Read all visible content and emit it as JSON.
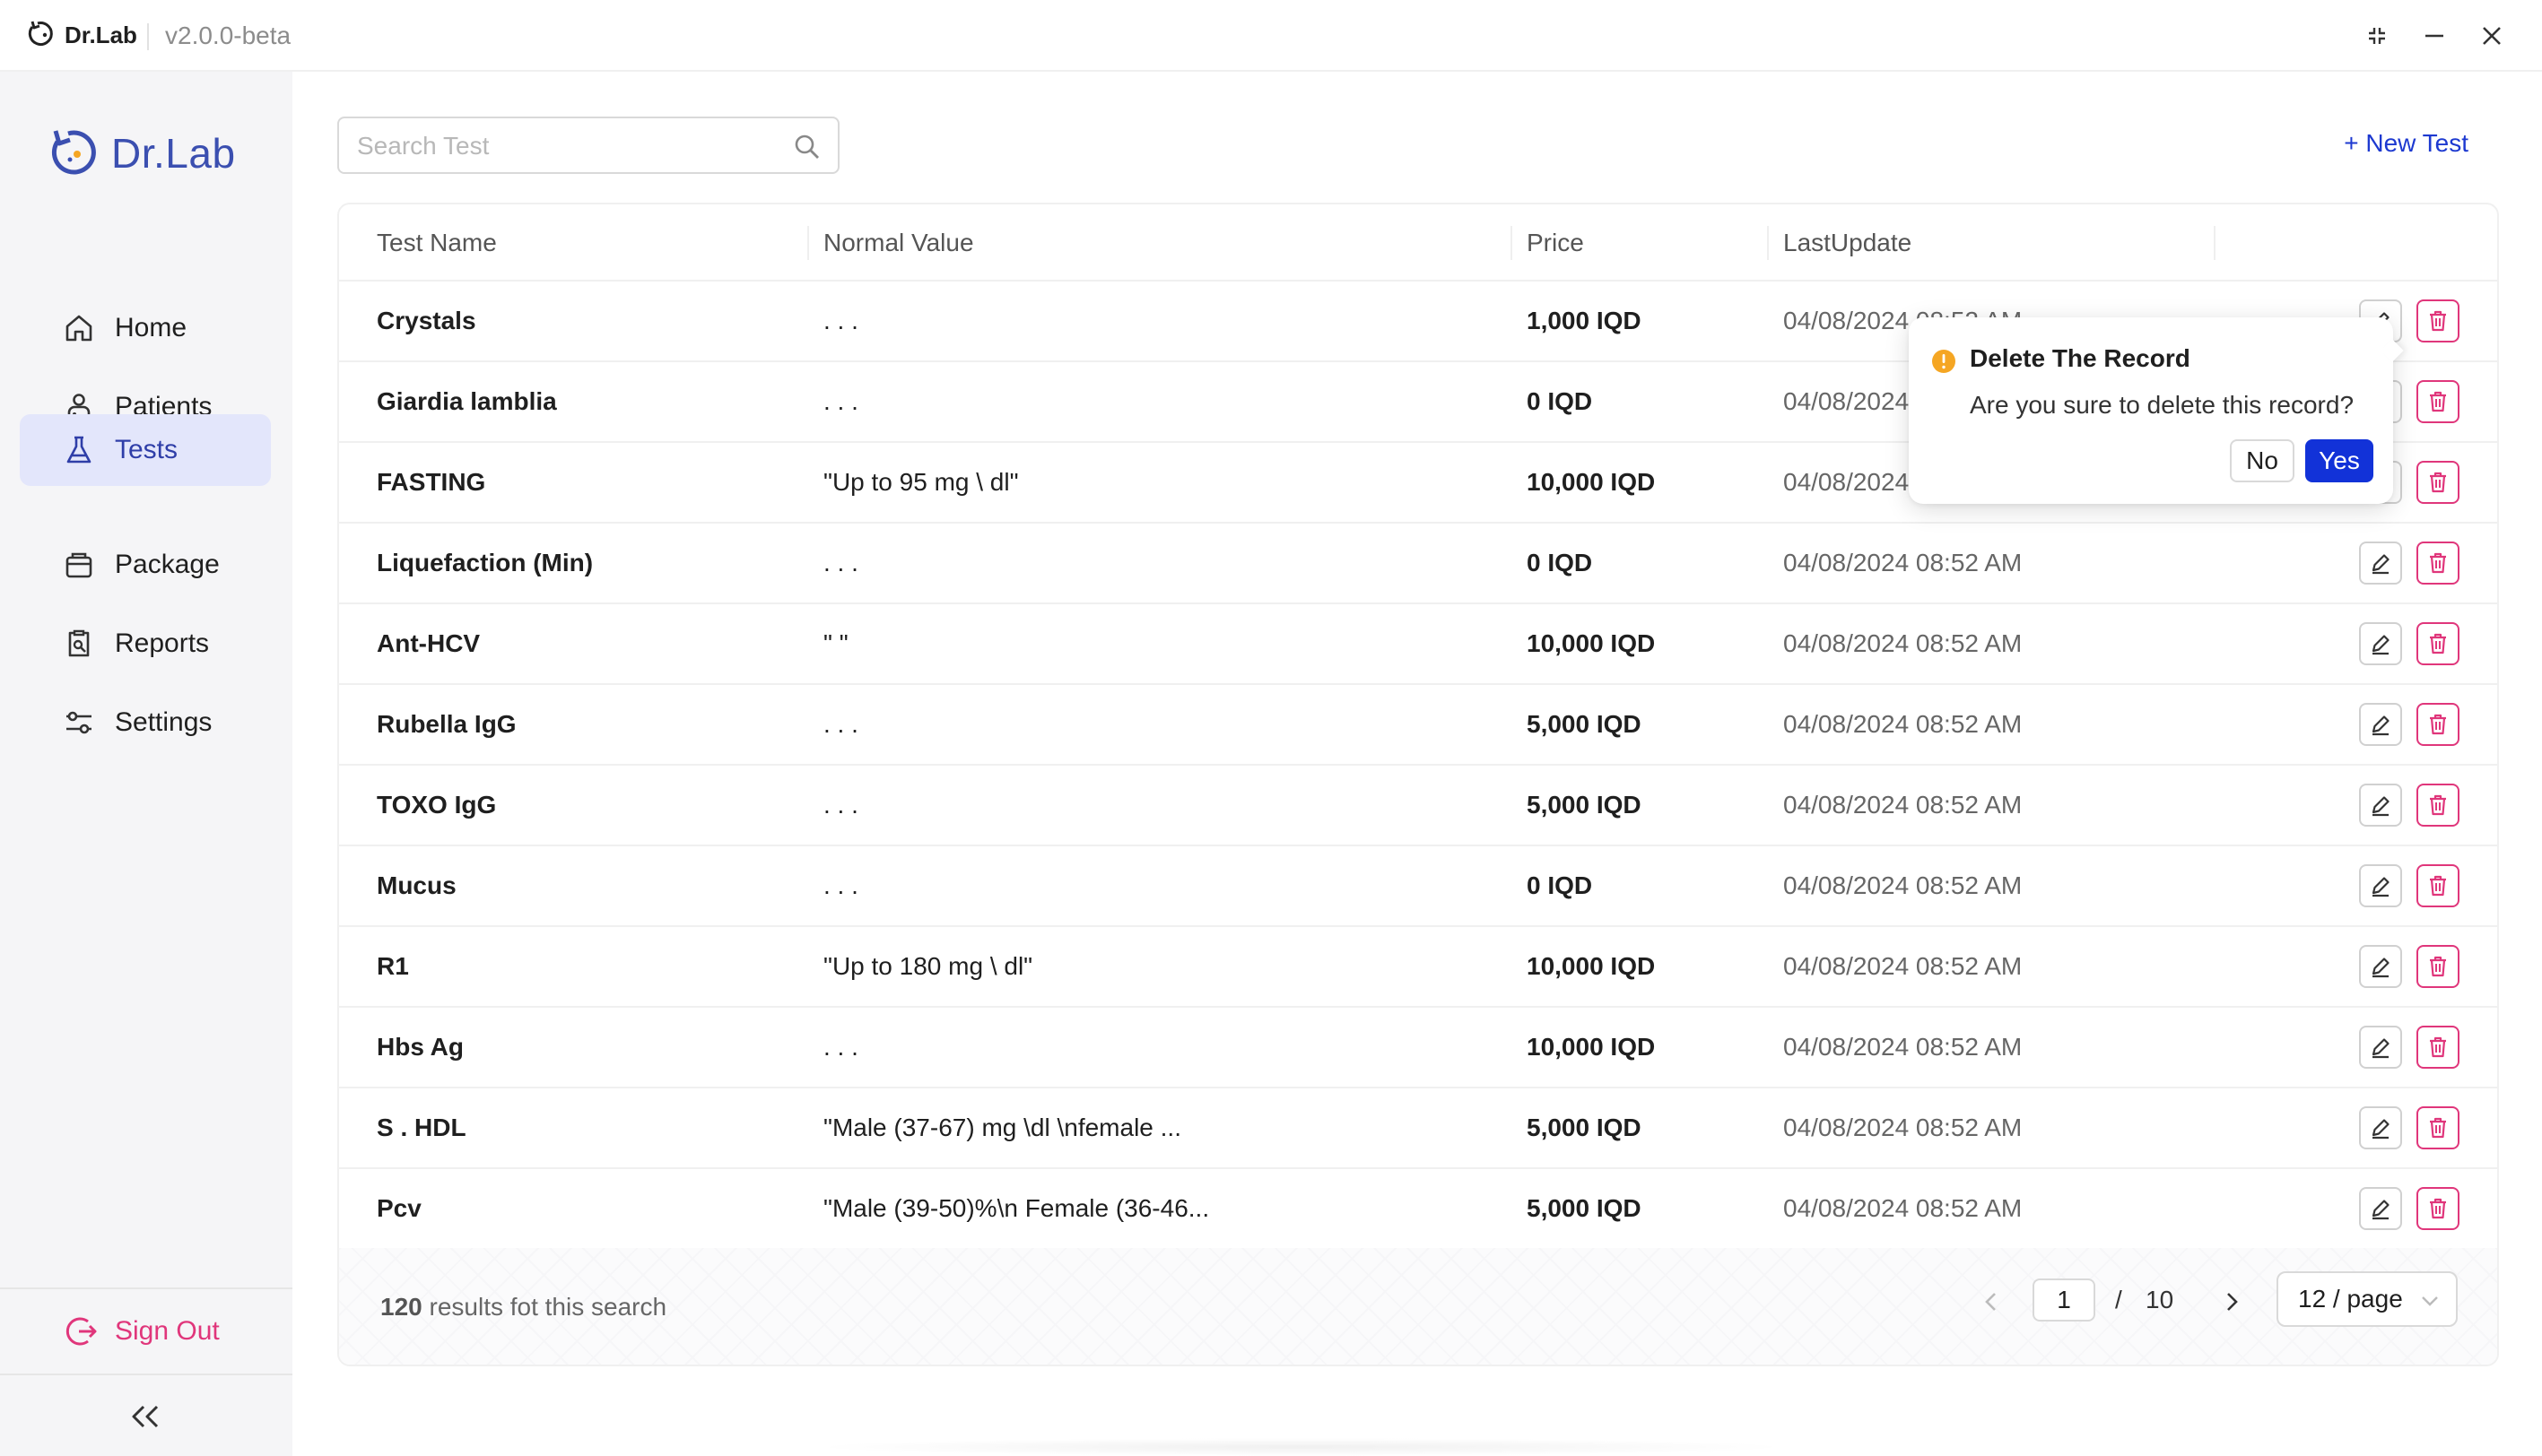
{
  "titlebar": {
    "app_name": "Dr.Lab",
    "version": "v2.0.0-beta",
    "icons": [
      "app-logo-icon",
      "shrink-icon",
      "minimize-icon",
      "close-icon"
    ]
  },
  "sidebar": {
    "brand": "Dr.Lab",
    "items": [
      {
        "label": "Home",
        "icon": "home-icon"
      },
      {
        "label": "Patients",
        "icon": "patients-icon"
      },
      {
        "label": "Tests",
        "icon": "flask-icon",
        "active": true
      },
      {
        "label": "Package",
        "icon": "package-icon"
      },
      {
        "label": "Reports",
        "icon": "reports-icon"
      },
      {
        "label": "Settings",
        "icon": "settings-icon"
      }
    ],
    "sign_out": "Sign Out",
    "collapse_icon": "double-chevron-left-icon"
  },
  "toolbar": {
    "search_placeholder": "Search Test",
    "new_test": "+ New Test"
  },
  "table": {
    "columns": [
      "Test Name",
      "Normal Value",
      "Price",
      "LastUpdate"
    ],
    "rows": [
      {
        "name": "Crystals",
        "normal": ". . .",
        "price": "1,000 IQD",
        "updated": "04/08/2024 08:52 AM"
      },
      {
        "name": "Giardia lamblia",
        "normal": ". . .",
        "price": "0 IQD",
        "updated": "04/08/2024 08:52 AM"
      },
      {
        "name": "FASTING",
        "normal": "\"Up to 95 mg \\ dl\"",
        "price": "10,000 IQD",
        "updated": "04/08/2024 08:52 AM"
      },
      {
        "name": "Liquefaction (Min)",
        "normal": ". . .",
        "price": "0 IQD",
        "updated": "04/08/2024 08:52 AM"
      },
      {
        "name": "Ant-HCV",
        "normal": "\" \"",
        "price": "10,000 IQD",
        "updated": "04/08/2024 08:52 AM"
      },
      {
        "name": "Rubella IgG",
        "normal": ". . .",
        "price": "5,000 IQD",
        "updated": "04/08/2024 08:52 AM"
      },
      {
        "name": "TOXO IgG",
        "normal": ". . .",
        "price": "5,000 IQD",
        "updated": "04/08/2024 08:52 AM"
      },
      {
        "name": "Mucus",
        "normal": ". . .",
        "price": "0 IQD",
        "updated": "04/08/2024 08:52 AM"
      },
      {
        "name": "R1",
        "normal": "\"Up to 180 mg \\ dl\"",
        "price": "10,000 IQD",
        "updated": "04/08/2024 08:52 AM"
      },
      {
        "name": "Hbs Ag",
        "normal": ". . .",
        "price": "10,000 IQD",
        "updated": "04/08/2024 08:52 AM"
      },
      {
        "name": "S . HDL",
        "normal": "\"Male (37-67) mg \\dl \\nfemale ...",
        "price": "5,000 IQD",
        "updated": "04/08/2024 08:52 AM"
      },
      {
        "name": "Pcv",
        "normal": "\"Male (39-50)%\\n Female (36-46...",
        "price": "5,000 IQD",
        "updated": "04/08/2024 08:52 AM"
      }
    ],
    "row_action_icons": [
      "edit-icon",
      "trash-icon"
    ]
  },
  "footer": {
    "results_count": "120",
    "results_text": " results fot this search",
    "current_page": "1",
    "page_separator": "/",
    "total_pages": "10",
    "page_size": "12 / page"
  },
  "popconfirm": {
    "title": "Delete The Record",
    "description": "Are you sure to delete this record?",
    "no_label": "No",
    "yes_label": "Yes",
    "icon": "warning-icon"
  },
  "colors": {
    "accent": "#1d39d0",
    "brand": "#3b4fb0",
    "danger": "#e0367b",
    "warning": "#f5a623",
    "active_nav_bg": "#e3e6fb"
  }
}
